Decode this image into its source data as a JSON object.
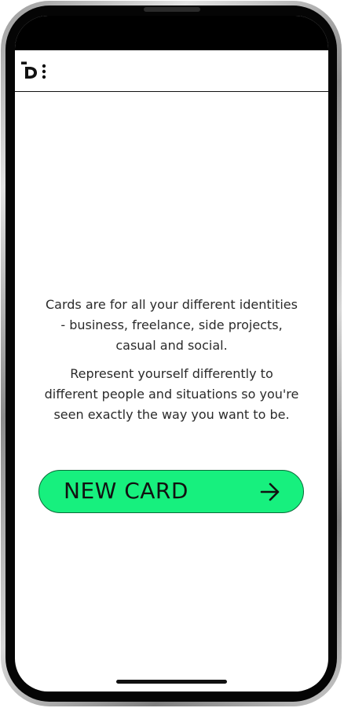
{
  "app": {
    "logo_icon": "d-logo-icon",
    "menu_icon": "vertical-dots-menu-icon"
  },
  "main": {
    "intro_paragraph_1": "Cards are for all your different identities - business, freelance, side projects, casual and social.",
    "intro_paragraph_2": "Represent yourself differently to different people and situations so you're seen exactly the way you want to be.",
    "new_card_label": "NEW CARD",
    "new_card_icon": "arrow-right-icon"
  },
  "colors": {
    "accent": "#17f07e",
    "text": "#2a2a2a",
    "frame": "#050505"
  }
}
